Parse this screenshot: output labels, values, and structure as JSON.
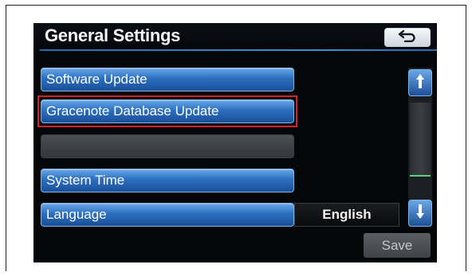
{
  "header": {
    "title": "General Settings",
    "back_icon": "back-arrow-icon"
  },
  "menu": {
    "items": [
      {
        "label": "Software Update"
      },
      {
        "label": "Gracenote Database Update",
        "highlighted": true
      },
      {
        "label": ""
      },
      {
        "label": "System Time"
      },
      {
        "label": "Language",
        "value": "English"
      }
    ]
  },
  "scroll": {
    "up_icon": "scroll-up-icon",
    "down_icon": "scroll-down-icon"
  },
  "footer": {
    "save_label": "Save"
  },
  "colors": {
    "accent": "#2b6fc0",
    "highlight": "#d3222a",
    "indicator": "#5fd07a"
  }
}
